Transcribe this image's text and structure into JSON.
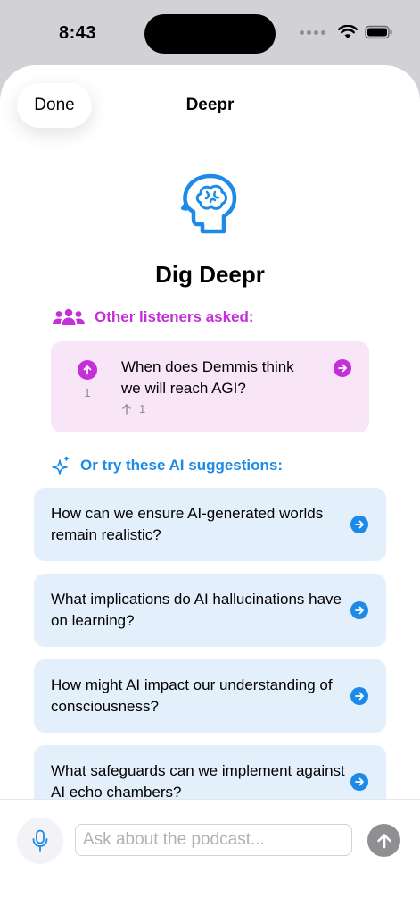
{
  "status_bar": {
    "time": "8:43"
  },
  "nav": {
    "done_label": "Done",
    "title": "Deepr"
  },
  "hero": {
    "title": "Dig Deepr"
  },
  "listeners": {
    "heading": "Other listeners asked:",
    "question": {
      "text": "When does Demmis think we will reach AGI?",
      "votes": "1",
      "upvotes": "1"
    }
  },
  "ai": {
    "heading": "Or try these AI suggestions:",
    "suggestions": [
      {
        "text": "How can we ensure AI-generated worlds remain realistic?"
      },
      {
        "text": "What implications do AI hallucinations have on learning?"
      },
      {
        "text": "How might AI impact our understanding of consciousness?"
      },
      {
        "text": "What safeguards can we implement against AI echo chambers?"
      }
    ]
  },
  "input": {
    "placeholder": "Ask about the podcast..."
  },
  "colors": {
    "accent_pink": "#c42fd8",
    "accent_blue": "#1c8ae6",
    "card_pink": "#f8e5f8",
    "card_blue": "#e3f0fc"
  },
  "icons": {
    "wifi": "wifi-icon",
    "battery": "battery-icon",
    "brain": "brain-icon",
    "group": "people-group-icon",
    "sparkle": "sparkle-icon",
    "mic": "microphone-icon",
    "send": "arrow-up-icon",
    "go": "arrow-right-circle-icon"
  }
}
